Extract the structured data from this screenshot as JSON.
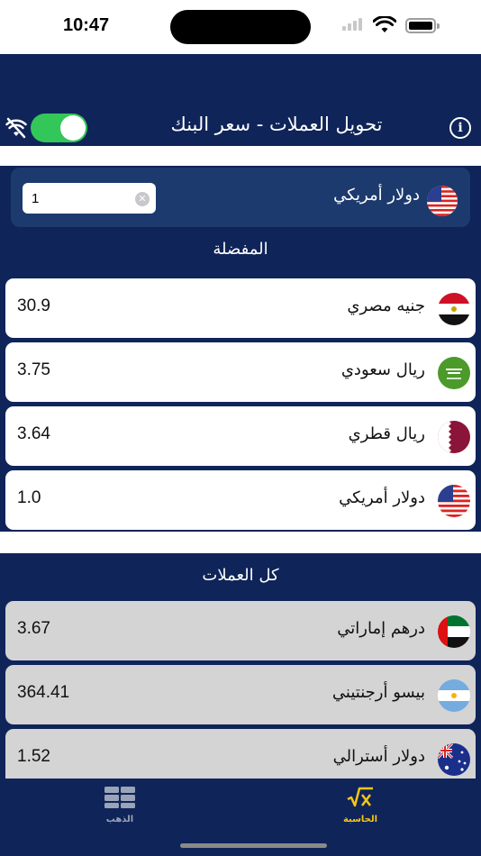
{
  "status_bar": {
    "time": "10:47"
  },
  "header": {
    "title": "تحويل العملات - سعر البنك",
    "info_icon": "info-icon",
    "online_toggle": true
  },
  "converter": {
    "currency_label": "دولار أمريكي",
    "amount_value": "1",
    "amount_placeholder": ""
  },
  "favorites": {
    "title": "المفضلة",
    "items": [
      {
        "name": "جنيه مصري",
        "value": "30.9",
        "flag": "egypt-flag-icon"
      },
      {
        "name": "ريال سعودي",
        "value": "3.75",
        "flag": "saudi-flag-icon"
      },
      {
        "name": "ريال قطري",
        "value": "3.64",
        "flag": "qatar-flag-icon"
      },
      {
        "name": "دولار أمريكي",
        "value": "1.0",
        "flag": "usa-flag-icon"
      }
    ]
  },
  "all_currencies": {
    "title": "كل العملات",
    "items": [
      {
        "name": "درهم إماراتي",
        "value": "3.67",
        "flag": "uae-flag-icon"
      },
      {
        "name": "بيسو أرجنتيني",
        "value": "364.41",
        "flag": "argentina-flag-icon"
      },
      {
        "name": "دولار أسترالي",
        "value": "1.52",
        "flag": "australia-flag-icon"
      }
    ]
  },
  "tabbar": {
    "gold_label": "الذهب",
    "calculator_label": "الحاسبة",
    "active_color": "#f5c518",
    "inactive_color": "#9aa3b8"
  },
  "colors": {
    "navy": "#0f2458",
    "card": "#1c3a6e",
    "toggle_on": "#33c759"
  }
}
